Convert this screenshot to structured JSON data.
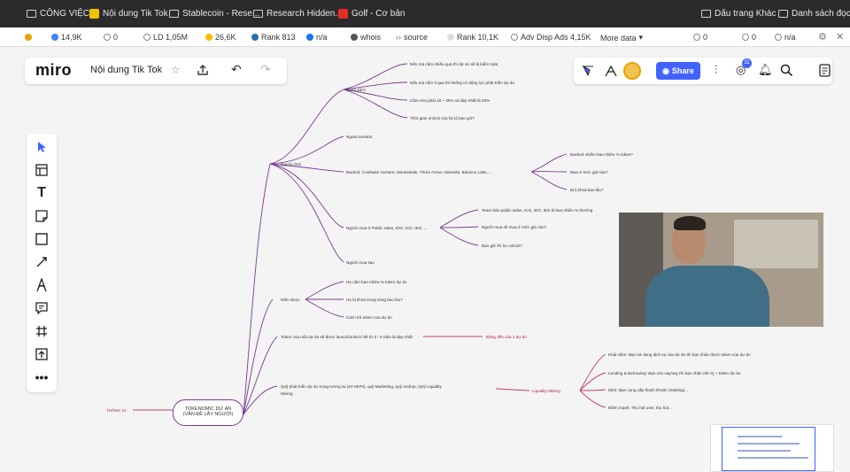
{
  "browser": {
    "bookmarks": [
      {
        "label": "CÔNG VIỆC",
        "icon": "folder-icon"
      },
      {
        "label": "Nội dung Tik Tok",
        "icon": "miro-favicon-icon"
      },
      {
        "label": "Stablecoin - Rese...",
        "icon": "page-icon"
      },
      {
        "label": "Research Hidden...",
        "icon": "page-icon"
      },
      {
        "label": "Golf - Cơ bản",
        "icon": "youtube-icon"
      },
      {
        "label": "Dấu trang Khác",
        "icon": "folder-icon"
      },
      {
        "label": "Danh sách đọc",
        "icon": "reading-list-icon"
      }
    ],
    "extensions": [
      {
        "label": "14,9K",
        "icon": "google-icon"
      },
      {
        "label": "0",
        "icon": "links-icon"
      },
      {
        "label": "LD 1,05M",
        "icon": "links-icon"
      },
      {
        "label": "26,6K",
        "icon": "bing-icon"
      },
      {
        "label": "Rank 813",
        "icon": "rank-icon"
      },
      {
        "label": "n/a",
        "icon": "facebook-icon"
      },
      {
        "label": "whois",
        "icon": "whois-icon"
      },
      {
        "label": "source",
        "icon": "source-icon"
      },
      {
        "label": "Rank 10,1K",
        "icon": "rank-icon"
      },
      {
        "label": "Adv Disp Ads 4,15K",
        "icon": "ads-icon"
      },
      {
        "label": "More data",
        "icon": "chevron-down-icon"
      },
      {
        "label": "0",
        "icon": "links-icon"
      },
      {
        "label": "0",
        "icon": "links-icon"
      },
      {
        "label": "n/a",
        "icon": "links-icon"
      }
    ]
  },
  "miro": {
    "logo": "miro",
    "board_name": "Nội dung Tik Tok",
    "share_label": "Share",
    "notification_count": "11",
    "tools": [
      "select-cursor-icon",
      "templates-icon",
      "text-icon",
      "sticky-note-icon",
      "shape-icon",
      "connection-line-icon",
      "pen-icon",
      "comment-icon",
      "frame-icon",
      "upload-icon",
      "more-tools-icon"
    ]
  },
  "mindmap": {
    "root": "TOKENOMIC DỰ ÁN\n(VẤN ĐỀ LẤY NGƯỜI)",
    "left_label": "THẮNG 10",
    "nguoi_choi": "Người chơi",
    "team_dev": "Team DEV",
    "team_dev_items": [
      "Nếu mà cầm nhiều quá thì dự án sẽ bị kiểm soát",
      "Nếu mà cầm ít quá thì không có động lực phát triển dự án",
      "Cầm vừa phải 15 – 25% và đẹp nhất là 20%",
      "Thời gian unlock của họ là bao giờ?"
    ],
    "ngoai_investor": "Ngoài Investor",
    "backed": "Backed: Coinbase Venture, Moonwhale, Three Arrow, Alameda, Binance Labs, ...",
    "backed_items": [
      "Backed chiếm bao nhiêu % token?",
      "Mua ở mức giá nào?",
      "Bị lị khoá bao lâu?"
    ],
    "nguoi_mua": "Người mua ở Public sales, IDO, ICO, IEO, ...",
    "nguoi_mua_items": [
      "Team bán public sales, ICO, IDO, IEO là bao nhiêu % thường",
      "Người mua sẽ mua ở mức giá nào?",
      "Bao giờ thì họ unlock?"
    ],
    "nguoi_mua_sau": "Người mua sau",
    "nam_duoc": "Nắm được",
    "nam_duoc_items": [
      "Họ cầm bao nhiêu % token dự án",
      "Họ bị khoá trong vòng bao lâu?",
      "Cách trả token của dự án"
    ],
    "token_line": "Token của một dự án sẽ được launch/unlock hết từ 3 - 5 năm là đẹp nhất",
    "token_line_right": "Đăng đến của 1 dự án",
    "quy_line": "Quỹ phát triển dự án trong tương lai (DI-VEPs), quỹ Marketing, quỹ Airdrop, Quỹ Liquidity",
    "quy_line2": "Mining",
    "liquidity_mining": "Liquidity Mining",
    "lm_items": [
      "Khái niệm: Bạn sử dụng dịch vụ của dự án thì bạn nhận được token của dự án",
      "Lending & Borrowing: Bạn cho vay/vay thì bạn nhận nên tỷ + token dự án",
      "DEX: Bạn cung cấp thanh khoản (Staking)...",
      "Điểm mạnh: Thu hút user, thu hút..."
    ]
  }
}
